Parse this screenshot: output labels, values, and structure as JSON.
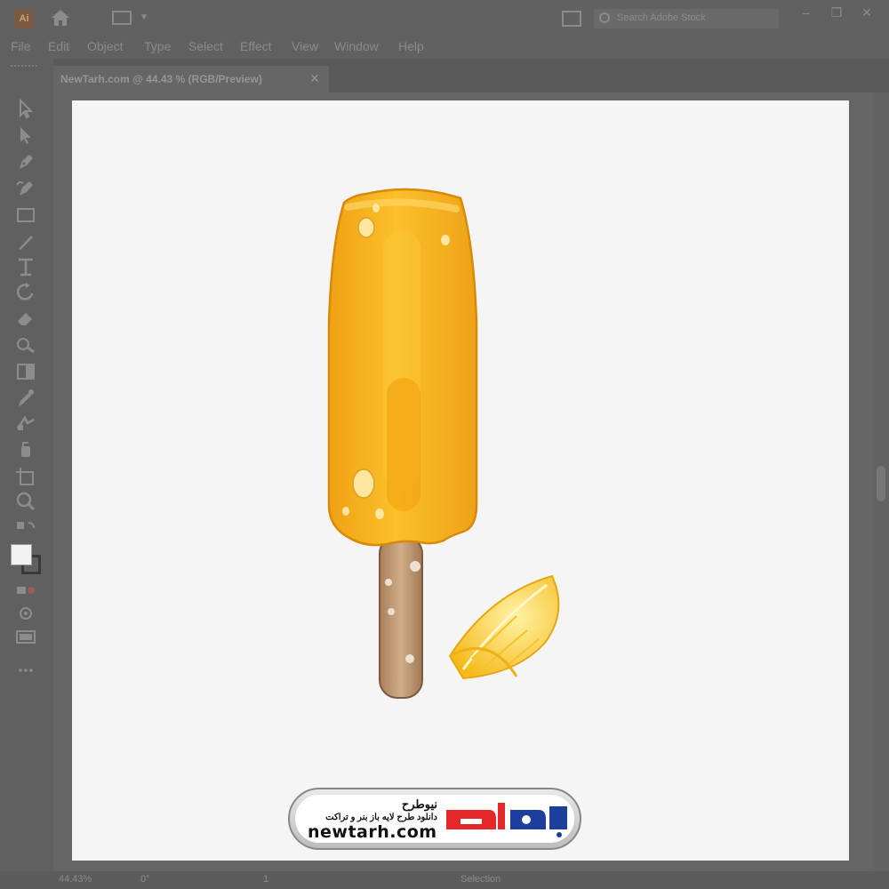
{
  "app": {
    "logo_text": "Ai",
    "search_placeholder": "Search Adobe Stock",
    "window_controls": {
      "minimize": "–",
      "maximize": "❐",
      "close": "✕"
    }
  },
  "menu": {
    "items": [
      "File",
      "Edit",
      "Object",
      "Type",
      "Select",
      "Effect",
      "View",
      "Window",
      "Help"
    ]
  },
  "document": {
    "tab_title": "NewTarh.com @ 44.43 % (RGB/Preview)",
    "close_glyph": "✕"
  },
  "tools": [
    "selection-tool",
    "direct-selection-tool",
    "pen-tool",
    "curvature-tool",
    "rectangle-tool",
    "paintbrush-tool",
    "type-tool",
    "rotate-tool",
    "eraser-tool",
    "shape-builder-tool",
    "gradient-tool",
    "eyedropper-tool",
    "blend-tool",
    "symbol-sprayer-tool",
    "artboard-tool",
    "zoom-tool",
    "swap-fill-stroke",
    "fill-stroke-swatch",
    "draw-mode",
    "screen-mode",
    "more-tools"
  ],
  "statusbar": {
    "zoom": "44.43%",
    "rotation": "0°",
    "artboard_num": "1",
    "mode": "Selection"
  },
  "watermark": {
    "brand_fa": "نیوطرح",
    "desc_fa": "دانلود طرح لایه باز بنر و تراکت",
    "url": "newtarh.com"
  },
  "colors": {
    "ui_gray": "#616161",
    "artboard": "#f5f5f5",
    "popsicle": "#f6b31d",
    "stick": "#c19c78",
    "lemon": "#f7c21e",
    "logo_red": "#e5262a",
    "logo_blue": "#1d3f9c"
  }
}
